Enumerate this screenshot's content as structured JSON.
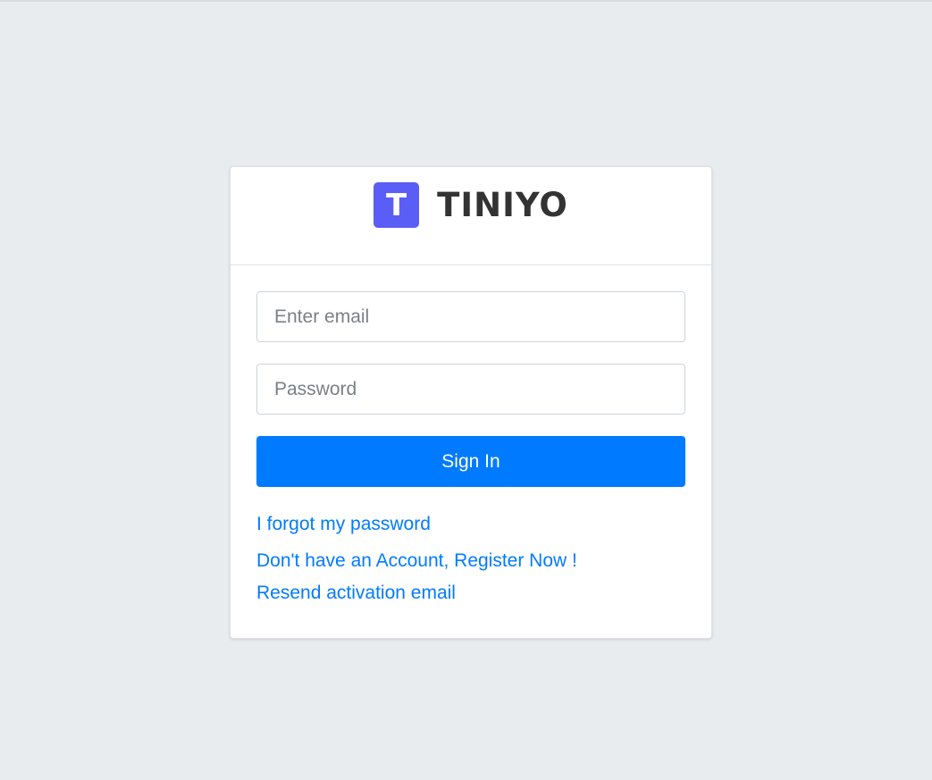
{
  "brand": {
    "logo_letter": "T",
    "name": "TINIYO",
    "logo_color": "#5b5ef6"
  },
  "form": {
    "email_placeholder": "Enter email",
    "email_value": "",
    "password_placeholder": "Password",
    "password_value": "",
    "signin_label": "Sign In"
  },
  "links": {
    "forgot_password": "I forgot my password",
    "register": "Don't have an Account, Register Now !",
    "resend_activation": "Resend activation email"
  },
  "colors": {
    "background": "#e9ecef",
    "primary": "#007bff",
    "card": "#ffffff"
  }
}
